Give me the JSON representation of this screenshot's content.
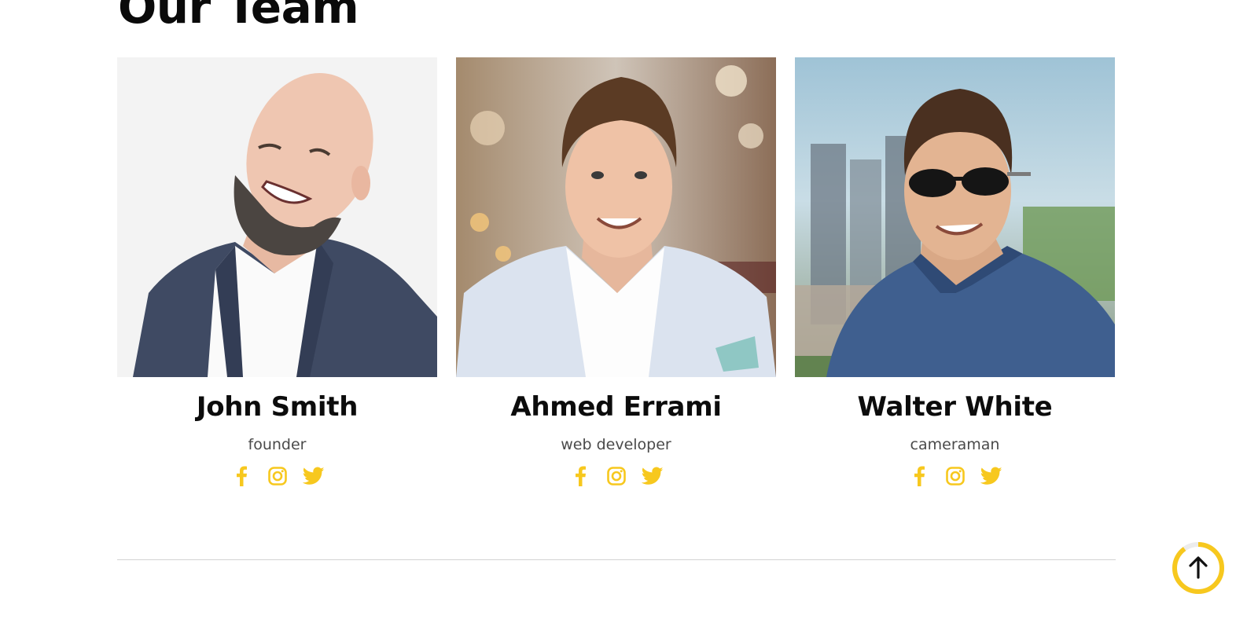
{
  "section": {
    "title": "Our Team"
  },
  "team": [
    {
      "name": "John Smith",
      "role": "founder",
      "photo_icon": "bald-bearded-man-laughing-photo"
    },
    {
      "name": "Ahmed Errami",
      "role": "web developer",
      "photo_icon": "smiling-man-light-blazer-photo"
    },
    {
      "name": "Walter White",
      "role": "cameraman",
      "photo_icon": "man-sunglasses-city-photo"
    }
  ],
  "social_icons": [
    "facebook-icon",
    "instagram-icon",
    "twitter-icon"
  ],
  "back_to_top": {
    "icon": "arrow-up-icon",
    "scroll_progress": 0.9
  },
  "colors": {
    "accent": "#f7c81e",
    "heading": "#0c0c0c",
    "muted_text": "#4a4a4a",
    "divider": "#d3d3d3"
  }
}
